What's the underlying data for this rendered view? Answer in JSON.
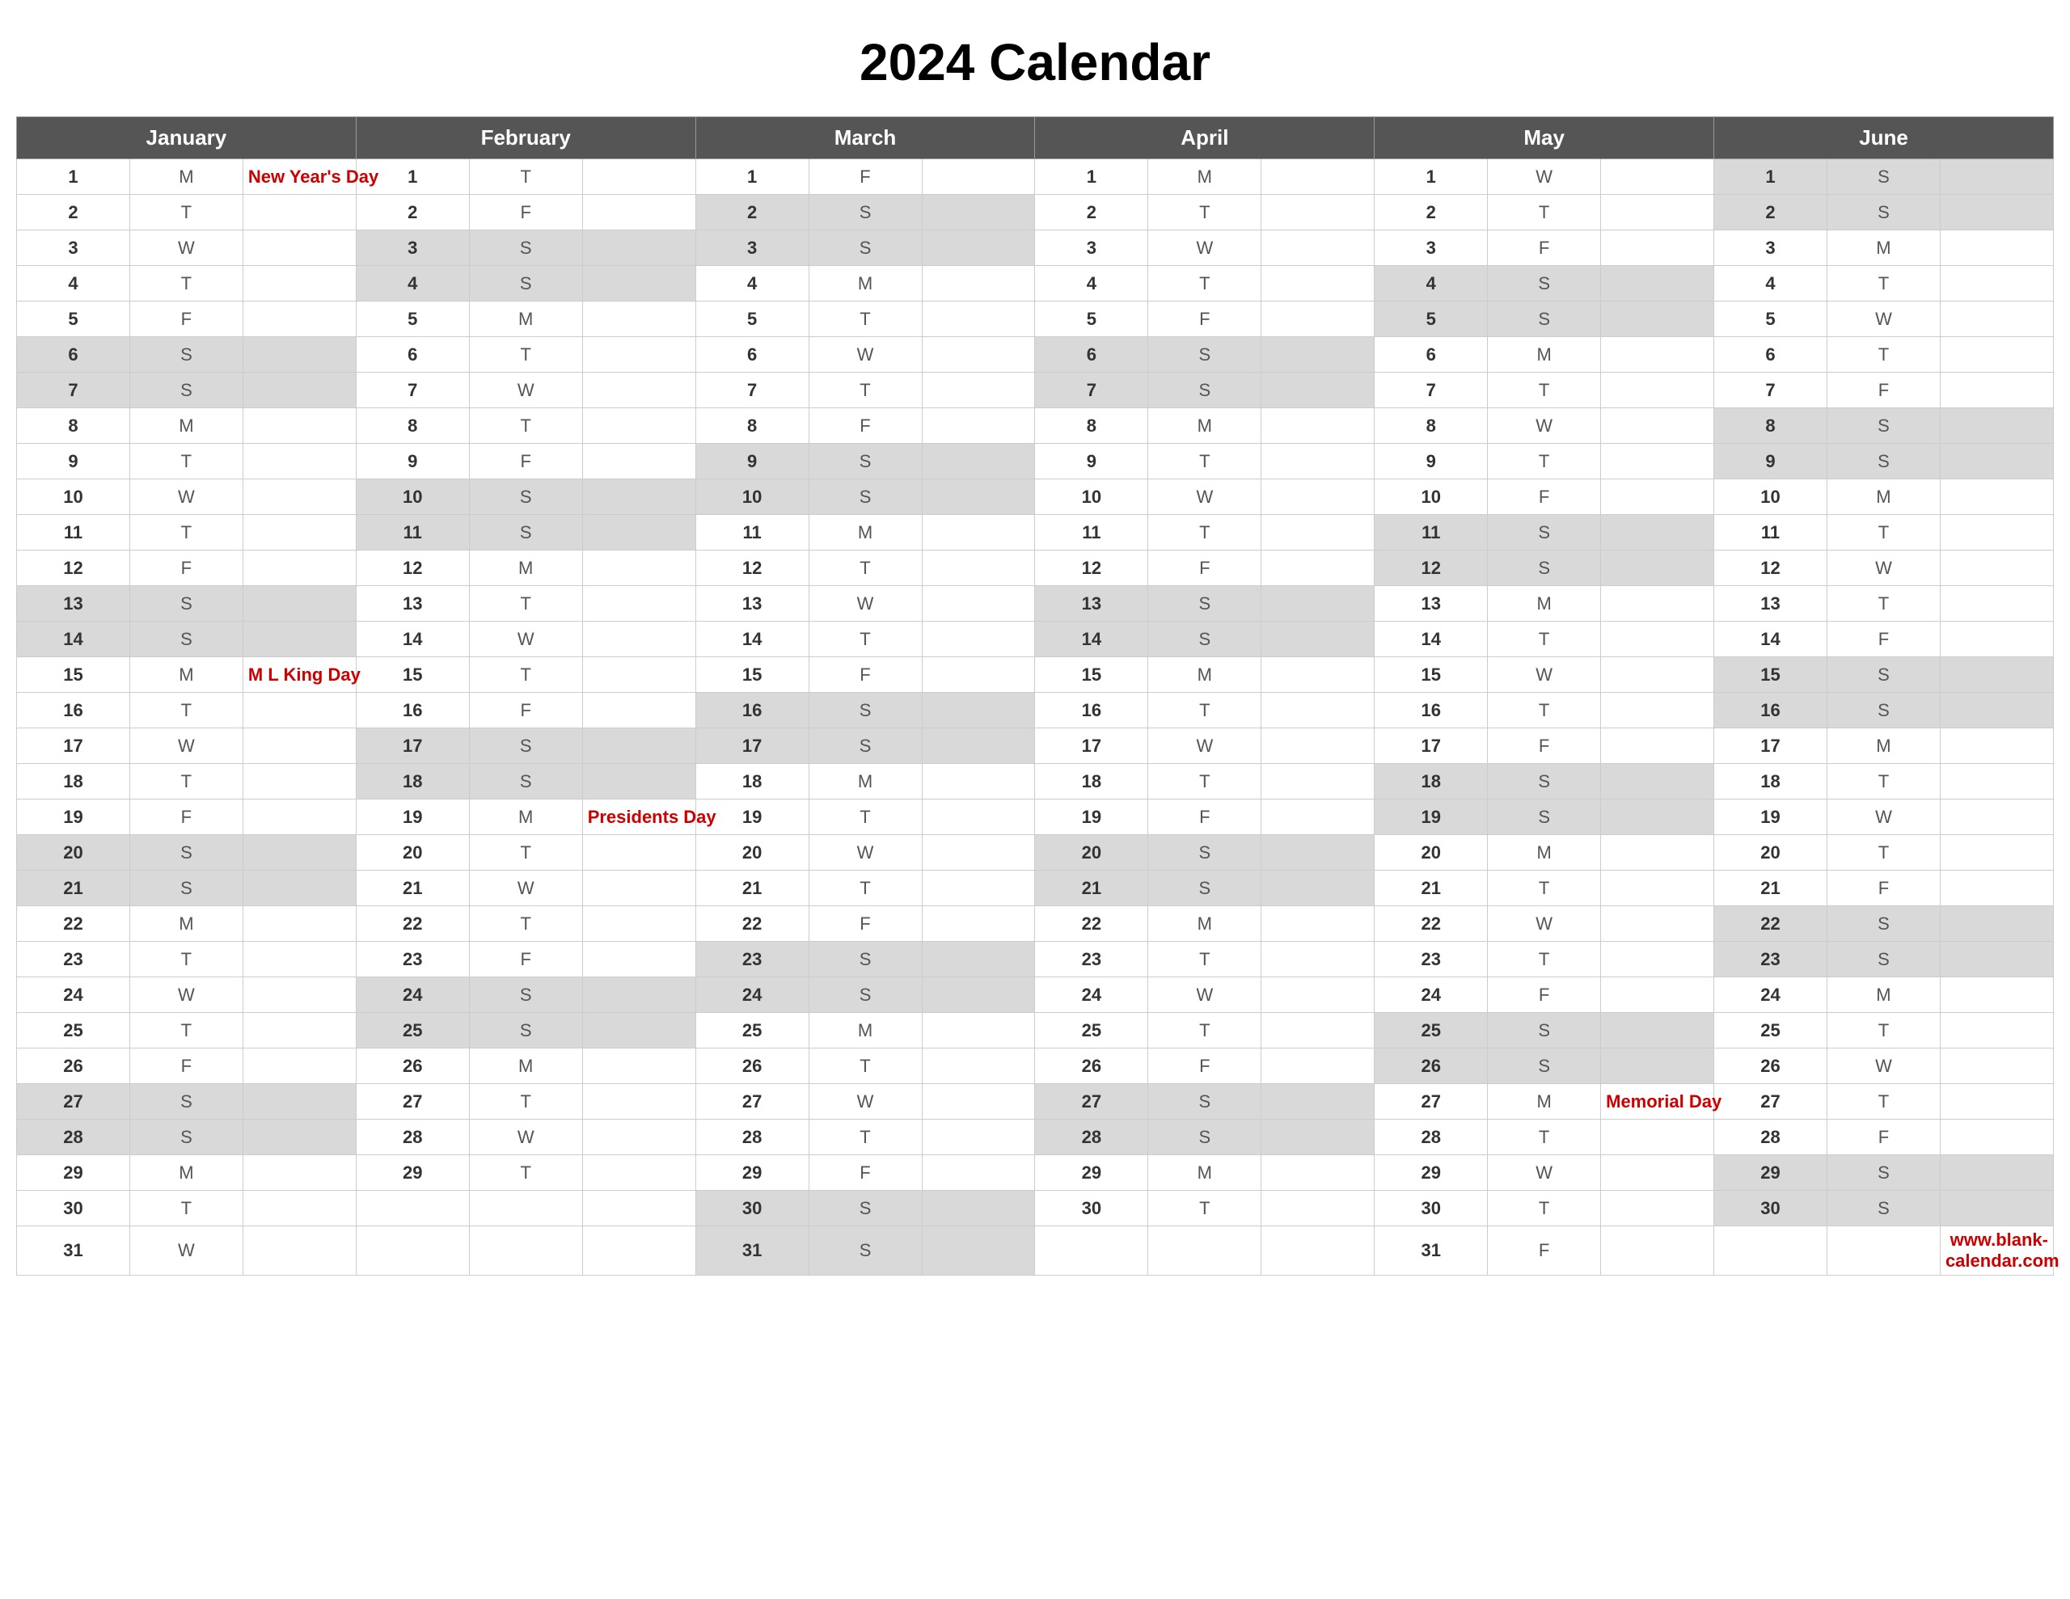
{
  "title": "2024 Calendar",
  "website": "www.blank-calendar.com",
  "months": [
    "January",
    "February",
    "March",
    "April",
    "May",
    "June"
  ],
  "days": {
    "jan": [
      {
        "d": 1,
        "day": "M",
        "event": "New Year's Day",
        "weekend": false
      },
      {
        "d": 2,
        "day": "T",
        "event": "",
        "weekend": false
      },
      {
        "d": 3,
        "day": "W",
        "event": "",
        "weekend": false
      },
      {
        "d": 4,
        "day": "T",
        "event": "",
        "weekend": false
      },
      {
        "d": 5,
        "day": "F",
        "event": "",
        "weekend": false
      },
      {
        "d": 6,
        "day": "S",
        "event": "",
        "weekend": true
      },
      {
        "d": 7,
        "day": "S",
        "event": "",
        "weekend": true
      },
      {
        "d": 8,
        "day": "M",
        "event": "",
        "weekend": false
      },
      {
        "d": 9,
        "day": "T",
        "event": "",
        "weekend": false
      },
      {
        "d": 10,
        "day": "W",
        "event": "",
        "weekend": false
      },
      {
        "d": 11,
        "day": "T",
        "event": "",
        "weekend": false
      },
      {
        "d": 12,
        "day": "F",
        "event": "",
        "weekend": false
      },
      {
        "d": 13,
        "day": "S",
        "event": "",
        "weekend": true
      },
      {
        "d": 14,
        "day": "S",
        "event": "",
        "weekend": true
      },
      {
        "d": 15,
        "day": "M",
        "event": "M L King Day",
        "weekend": false
      },
      {
        "d": 16,
        "day": "T",
        "event": "",
        "weekend": false
      },
      {
        "d": 17,
        "day": "W",
        "event": "",
        "weekend": false
      },
      {
        "d": 18,
        "day": "T",
        "event": "",
        "weekend": false
      },
      {
        "d": 19,
        "day": "F",
        "event": "",
        "weekend": false
      },
      {
        "d": 20,
        "day": "S",
        "event": "",
        "weekend": true
      },
      {
        "d": 21,
        "day": "S",
        "event": "",
        "weekend": true
      },
      {
        "d": 22,
        "day": "M",
        "event": "",
        "weekend": false
      },
      {
        "d": 23,
        "day": "T",
        "event": "",
        "weekend": false
      },
      {
        "d": 24,
        "day": "W",
        "event": "",
        "weekend": false
      },
      {
        "d": 25,
        "day": "T",
        "event": "",
        "weekend": false
      },
      {
        "d": 26,
        "day": "F",
        "event": "",
        "weekend": false
      },
      {
        "d": 27,
        "day": "S",
        "event": "",
        "weekend": true
      },
      {
        "d": 28,
        "day": "S",
        "event": "",
        "weekend": true
      },
      {
        "d": 29,
        "day": "M",
        "event": "",
        "weekend": false
      },
      {
        "d": 30,
        "day": "T",
        "event": "",
        "weekend": false
      },
      {
        "d": 31,
        "day": "W",
        "event": "",
        "weekend": false
      }
    ],
    "feb": [
      {
        "d": 1,
        "day": "T",
        "event": "",
        "weekend": false
      },
      {
        "d": 2,
        "day": "F",
        "event": "",
        "weekend": false
      },
      {
        "d": 3,
        "day": "S",
        "event": "",
        "weekend": true
      },
      {
        "d": 4,
        "day": "S",
        "event": "",
        "weekend": true
      },
      {
        "d": 5,
        "day": "M",
        "event": "",
        "weekend": false
      },
      {
        "d": 6,
        "day": "T",
        "event": "",
        "weekend": false
      },
      {
        "d": 7,
        "day": "W",
        "event": "",
        "weekend": false
      },
      {
        "d": 8,
        "day": "T",
        "event": "",
        "weekend": false
      },
      {
        "d": 9,
        "day": "F",
        "event": "",
        "weekend": false
      },
      {
        "d": 10,
        "day": "S",
        "event": "",
        "weekend": true
      },
      {
        "d": 11,
        "day": "S",
        "event": "",
        "weekend": true
      },
      {
        "d": 12,
        "day": "M",
        "event": "",
        "weekend": false
      },
      {
        "d": 13,
        "day": "T",
        "event": "",
        "weekend": false
      },
      {
        "d": 14,
        "day": "W",
        "event": "",
        "weekend": false
      },
      {
        "d": 15,
        "day": "T",
        "event": "",
        "weekend": false
      },
      {
        "d": 16,
        "day": "F",
        "event": "",
        "weekend": false
      },
      {
        "d": 17,
        "day": "S",
        "event": "",
        "weekend": true
      },
      {
        "d": 18,
        "day": "S",
        "event": "",
        "weekend": true
      },
      {
        "d": 19,
        "day": "M",
        "event": "Presidents Day",
        "weekend": false
      },
      {
        "d": 20,
        "day": "T",
        "event": "",
        "weekend": false
      },
      {
        "d": 21,
        "day": "W",
        "event": "",
        "weekend": false
      },
      {
        "d": 22,
        "day": "T",
        "event": "",
        "weekend": false
      },
      {
        "d": 23,
        "day": "F",
        "event": "",
        "weekend": false
      },
      {
        "d": 24,
        "day": "S",
        "event": "",
        "weekend": true
      },
      {
        "d": 25,
        "day": "S",
        "event": "",
        "weekend": true
      },
      {
        "d": 26,
        "day": "M",
        "event": "",
        "weekend": false
      },
      {
        "d": 27,
        "day": "T",
        "event": "",
        "weekend": false
      },
      {
        "d": 28,
        "day": "W",
        "event": "",
        "weekend": false
      },
      {
        "d": 29,
        "day": "T",
        "event": "",
        "weekend": false
      }
    ],
    "mar": [
      {
        "d": 1,
        "day": "F",
        "event": "",
        "weekend": false
      },
      {
        "d": 2,
        "day": "S",
        "event": "",
        "weekend": true
      },
      {
        "d": 3,
        "day": "S",
        "event": "",
        "weekend": true
      },
      {
        "d": 4,
        "day": "M",
        "event": "",
        "weekend": false
      },
      {
        "d": 5,
        "day": "T",
        "event": "",
        "weekend": false
      },
      {
        "d": 6,
        "day": "W",
        "event": "",
        "weekend": false
      },
      {
        "d": 7,
        "day": "T",
        "event": "",
        "weekend": false
      },
      {
        "d": 8,
        "day": "F",
        "event": "",
        "weekend": false
      },
      {
        "d": 9,
        "day": "S",
        "event": "",
        "weekend": true
      },
      {
        "d": 10,
        "day": "S",
        "event": "",
        "weekend": true
      },
      {
        "d": 11,
        "day": "M",
        "event": "",
        "weekend": false
      },
      {
        "d": 12,
        "day": "T",
        "event": "",
        "weekend": false
      },
      {
        "d": 13,
        "day": "W",
        "event": "",
        "weekend": false
      },
      {
        "d": 14,
        "day": "T",
        "event": "",
        "weekend": false
      },
      {
        "d": 15,
        "day": "F",
        "event": "",
        "weekend": false
      },
      {
        "d": 16,
        "day": "S",
        "event": "",
        "weekend": true
      },
      {
        "d": 17,
        "day": "S",
        "event": "",
        "weekend": true
      },
      {
        "d": 18,
        "day": "M",
        "event": "",
        "weekend": false
      },
      {
        "d": 19,
        "day": "T",
        "event": "",
        "weekend": false
      },
      {
        "d": 20,
        "day": "W",
        "event": "",
        "weekend": false
      },
      {
        "d": 21,
        "day": "T",
        "event": "",
        "weekend": false
      },
      {
        "d": 22,
        "day": "F",
        "event": "",
        "weekend": false
      },
      {
        "d": 23,
        "day": "S",
        "event": "",
        "weekend": true
      },
      {
        "d": 24,
        "day": "S",
        "event": "",
        "weekend": true
      },
      {
        "d": 25,
        "day": "M",
        "event": "",
        "weekend": false
      },
      {
        "d": 26,
        "day": "T",
        "event": "",
        "weekend": false
      },
      {
        "d": 27,
        "day": "W",
        "event": "",
        "weekend": false
      },
      {
        "d": 28,
        "day": "T",
        "event": "",
        "weekend": false
      },
      {
        "d": 29,
        "day": "F",
        "event": "",
        "weekend": false
      },
      {
        "d": 30,
        "day": "S",
        "event": "",
        "weekend": true
      },
      {
        "d": 31,
        "day": "S",
        "event": "",
        "weekend": true
      }
    ],
    "apr": [
      {
        "d": 1,
        "day": "M",
        "event": "",
        "weekend": false
      },
      {
        "d": 2,
        "day": "T",
        "event": "",
        "weekend": false
      },
      {
        "d": 3,
        "day": "W",
        "event": "",
        "weekend": false
      },
      {
        "d": 4,
        "day": "T",
        "event": "",
        "weekend": false
      },
      {
        "d": 5,
        "day": "F",
        "event": "",
        "weekend": false
      },
      {
        "d": 6,
        "day": "S",
        "event": "",
        "weekend": true
      },
      {
        "d": 7,
        "day": "S",
        "event": "",
        "weekend": true
      },
      {
        "d": 8,
        "day": "M",
        "event": "",
        "weekend": false
      },
      {
        "d": 9,
        "day": "T",
        "event": "",
        "weekend": false
      },
      {
        "d": 10,
        "day": "W",
        "event": "",
        "weekend": false
      },
      {
        "d": 11,
        "day": "T",
        "event": "",
        "weekend": false
      },
      {
        "d": 12,
        "day": "F",
        "event": "",
        "weekend": false
      },
      {
        "d": 13,
        "day": "S",
        "event": "",
        "weekend": true
      },
      {
        "d": 14,
        "day": "S",
        "event": "",
        "weekend": true
      },
      {
        "d": 15,
        "day": "M",
        "event": "",
        "weekend": false
      },
      {
        "d": 16,
        "day": "T",
        "event": "",
        "weekend": false
      },
      {
        "d": 17,
        "day": "W",
        "event": "",
        "weekend": false
      },
      {
        "d": 18,
        "day": "T",
        "event": "",
        "weekend": false
      },
      {
        "d": 19,
        "day": "F",
        "event": "",
        "weekend": false
      },
      {
        "d": 20,
        "day": "S",
        "event": "",
        "weekend": true
      },
      {
        "d": 21,
        "day": "S",
        "event": "",
        "weekend": true
      },
      {
        "d": 22,
        "day": "M",
        "event": "",
        "weekend": false
      },
      {
        "d": 23,
        "day": "T",
        "event": "",
        "weekend": false
      },
      {
        "d": 24,
        "day": "W",
        "event": "",
        "weekend": false
      },
      {
        "d": 25,
        "day": "T",
        "event": "",
        "weekend": false
      },
      {
        "d": 26,
        "day": "F",
        "event": "",
        "weekend": false
      },
      {
        "d": 27,
        "day": "S",
        "event": "",
        "weekend": true
      },
      {
        "d": 28,
        "day": "S",
        "event": "",
        "weekend": true
      },
      {
        "d": 29,
        "day": "M",
        "event": "",
        "weekend": false
      },
      {
        "d": 30,
        "day": "T",
        "event": "",
        "weekend": false
      }
    ],
    "may": [
      {
        "d": 1,
        "day": "W",
        "event": "",
        "weekend": false
      },
      {
        "d": 2,
        "day": "T",
        "event": "",
        "weekend": false
      },
      {
        "d": 3,
        "day": "F",
        "event": "",
        "weekend": false
      },
      {
        "d": 4,
        "day": "S",
        "event": "",
        "weekend": true
      },
      {
        "d": 5,
        "day": "S",
        "event": "",
        "weekend": true
      },
      {
        "d": 6,
        "day": "M",
        "event": "",
        "weekend": false
      },
      {
        "d": 7,
        "day": "T",
        "event": "",
        "weekend": false
      },
      {
        "d": 8,
        "day": "W",
        "event": "",
        "weekend": false
      },
      {
        "d": 9,
        "day": "T",
        "event": "",
        "weekend": false
      },
      {
        "d": 10,
        "day": "F",
        "event": "",
        "weekend": false
      },
      {
        "d": 11,
        "day": "S",
        "event": "",
        "weekend": true
      },
      {
        "d": 12,
        "day": "S",
        "event": "",
        "weekend": true
      },
      {
        "d": 13,
        "day": "M",
        "event": "",
        "weekend": false
      },
      {
        "d": 14,
        "day": "T",
        "event": "",
        "weekend": false
      },
      {
        "d": 15,
        "day": "W",
        "event": "",
        "weekend": false
      },
      {
        "d": 16,
        "day": "T",
        "event": "",
        "weekend": false
      },
      {
        "d": 17,
        "day": "F",
        "event": "",
        "weekend": false
      },
      {
        "d": 18,
        "day": "S",
        "event": "",
        "weekend": true
      },
      {
        "d": 19,
        "day": "S",
        "event": "",
        "weekend": true
      },
      {
        "d": 20,
        "day": "M",
        "event": "",
        "weekend": false
      },
      {
        "d": 21,
        "day": "T",
        "event": "",
        "weekend": false
      },
      {
        "d": 22,
        "day": "W",
        "event": "",
        "weekend": false
      },
      {
        "d": 23,
        "day": "T",
        "event": "",
        "weekend": false
      },
      {
        "d": 24,
        "day": "F",
        "event": "",
        "weekend": false
      },
      {
        "d": 25,
        "day": "S",
        "event": "",
        "weekend": true
      },
      {
        "d": 26,
        "day": "S",
        "event": "",
        "weekend": true
      },
      {
        "d": 27,
        "day": "M",
        "event": "Memorial Day",
        "weekend": false
      },
      {
        "d": 28,
        "day": "T",
        "event": "",
        "weekend": false
      },
      {
        "d": 29,
        "day": "W",
        "event": "",
        "weekend": false
      },
      {
        "d": 30,
        "day": "T",
        "event": "",
        "weekend": false
      },
      {
        "d": 31,
        "day": "F",
        "event": "",
        "weekend": false
      }
    ],
    "jun": [
      {
        "d": 1,
        "day": "S",
        "event": "",
        "weekend": true
      },
      {
        "d": 2,
        "day": "S",
        "event": "",
        "weekend": true
      },
      {
        "d": 3,
        "day": "M",
        "event": "",
        "weekend": false
      },
      {
        "d": 4,
        "day": "T",
        "event": "",
        "weekend": false
      },
      {
        "d": 5,
        "day": "W",
        "event": "",
        "weekend": false
      },
      {
        "d": 6,
        "day": "T",
        "event": "",
        "weekend": false
      },
      {
        "d": 7,
        "day": "F",
        "event": "",
        "weekend": false
      },
      {
        "d": 8,
        "day": "S",
        "event": "",
        "weekend": true
      },
      {
        "d": 9,
        "day": "S",
        "event": "",
        "weekend": true
      },
      {
        "d": 10,
        "day": "M",
        "event": "",
        "weekend": false
      },
      {
        "d": 11,
        "day": "T",
        "event": "",
        "weekend": false
      },
      {
        "d": 12,
        "day": "W",
        "event": "",
        "weekend": false
      },
      {
        "d": 13,
        "day": "T",
        "event": "",
        "weekend": false
      },
      {
        "d": 14,
        "day": "F",
        "event": "",
        "weekend": false
      },
      {
        "d": 15,
        "day": "S",
        "event": "",
        "weekend": true
      },
      {
        "d": 16,
        "day": "S",
        "event": "",
        "weekend": true
      },
      {
        "d": 17,
        "day": "M",
        "event": "",
        "weekend": false
      },
      {
        "d": 18,
        "day": "T",
        "event": "",
        "weekend": false
      },
      {
        "d": 19,
        "day": "W",
        "event": "",
        "weekend": false
      },
      {
        "d": 20,
        "day": "T",
        "event": "",
        "weekend": false
      },
      {
        "d": 21,
        "day": "F",
        "event": "",
        "weekend": false
      },
      {
        "d": 22,
        "day": "S",
        "event": "",
        "weekend": true
      },
      {
        "d": 23,
        "day": "S",
        "event": "",
        "weekend": true
      },
      {
        "d": 24,
        "day": "M",
        "event": "",
        "weekend": false
      },
      {
        "d": 25,
        "day": "T",
        "event": "",
        "weekend": false
      },
      {
        "d": 26,
        "day": "W",
        "event": "",
        "weekend": false
      },
      {
        "d": 27,
        "day": "T",
        "event": "",
        "weekend": false
      },
      {
        "d": 28,
        "day": "F",
        "event": "",
        "weekend": false
      },
      {
        "d": 29,
        "day": "S",
        "event": "",
        "weekend": true
      },
      {
        "d": 30,
        "day": "S",
        "event": "",
        "weekend": true
      }
    ]
  }
}
